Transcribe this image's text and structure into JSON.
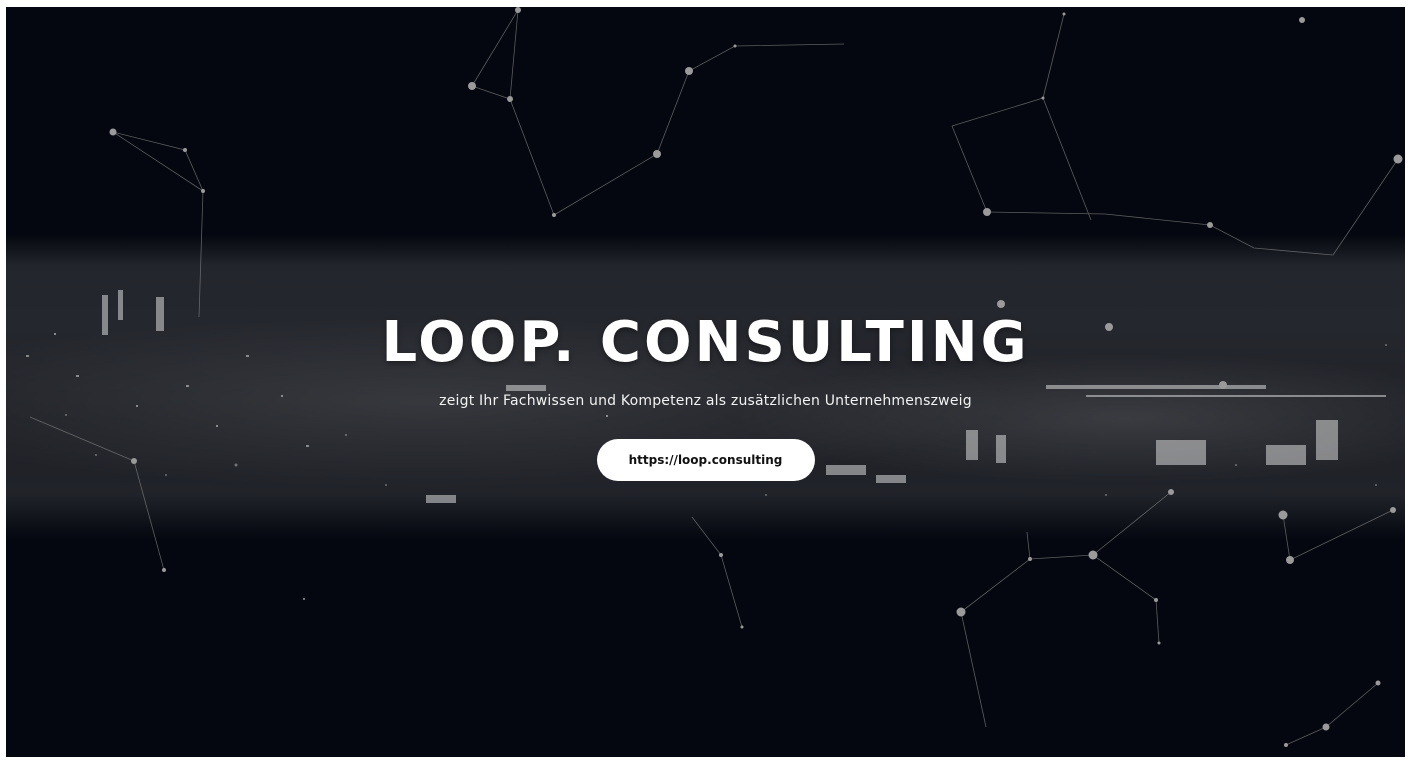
{
  "hero": {
    "title": "LOOP. CONSULTING",
    "subtitle": "zeigt Ihr Fachwissen und Kompetenz als zusätzlichen Unternehmenszweig",
    "button_label": "https://loop.consulting"
  },
  "colors": {
    "background": "#04070f",
    "text": "#ffffff",
    "button_bg": "#ffffff",
    "button_text": "#111111"
  }
}
